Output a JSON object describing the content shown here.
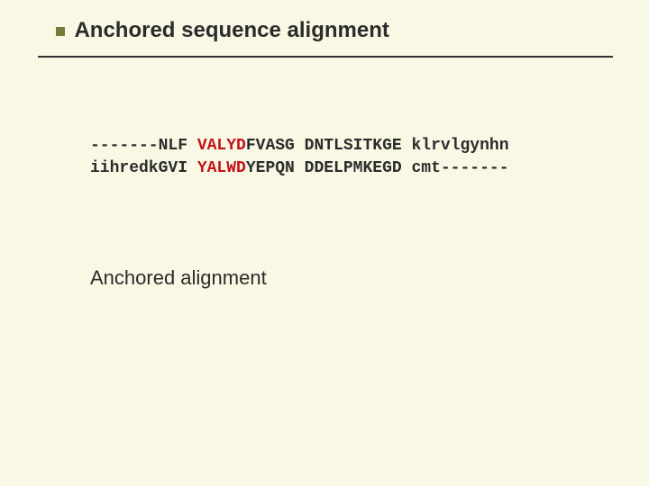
{
  "title": "Anchored sequence alignment",
  "alignment": {
    "row1": {
      "pre": "-------NLF ",
      "red": "VALYD",
      "rest": "FVASG DNTLSITKGE klrvlgynhn"
    },
    "row2": {
      "pre": "iihredkGVI ",
      "red": "YALWD",
      "rest": "YEPQN DDELPMKEGD cmt-------"
    }
  },
  "subtitle": "Anchored alignment"
}
